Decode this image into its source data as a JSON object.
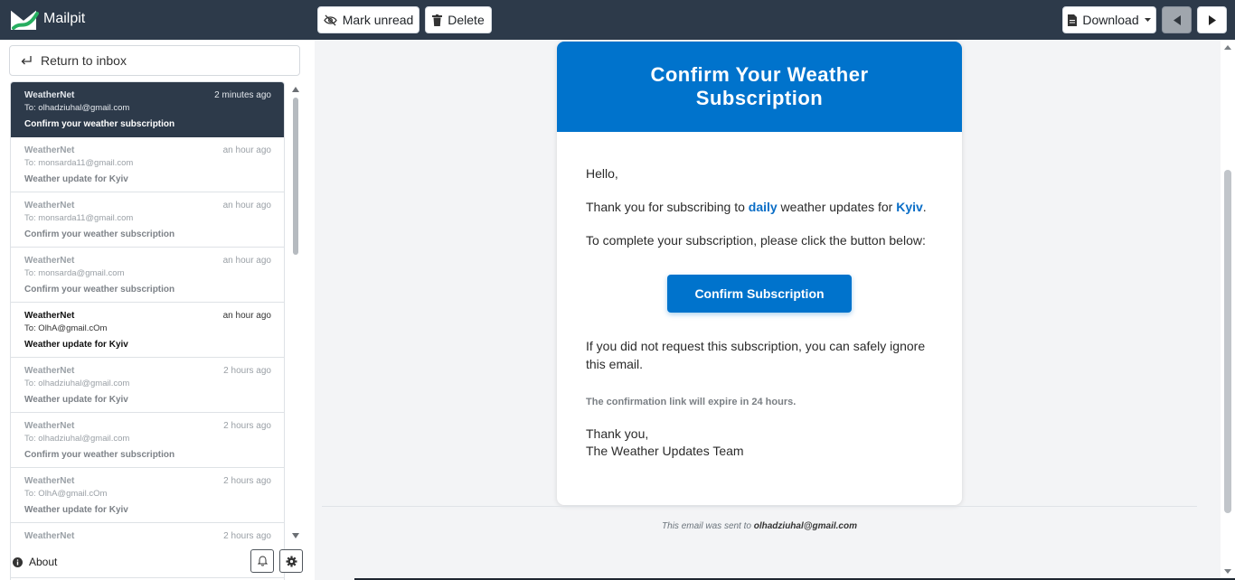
{
  "app": {
    "name": "Mailpit",
    "accent": "#2d3a4a",
    "brand_blue": "#0073cc"
  },
  "toolbar": {
    "mark_unread": "Mark unread",
    "delete": "Delete",
    "download": "Download",
    "prev_icon": "triangle-left-icon",
    "next_icon": "triangle-right-icon"
  },
  "sidebar": {
    "return_label": "Return to inbox",
    "about_label": "About",
    "messages": [
      {
        "from": "WeatherNet",
        "time": "2 minutes ago",
        "to": "To: olhadziuhal@gmail.com",
        "subject": "Confirm your weather subscription",
        "state": "active"
      },
      {
        "from": "WeatherNet",
        "time": "an hour ago",
        "to": "To: monsarda11@gmail.com",
        "subject": "Weather update for Kyiv",
        "state": "read"
      },
      {
        "from": "WeatherNet",
        "time": "an hour ago",
        "to": "To: monsarda11@gmail.com",
        "subject": "Confirm your weather subscription",
        "state": "read"
      },
      {
        "from": "WeatherNet",
        "time": "an hour ago",
        "to": "To: monsarda@gmail.com",
        "subject": "Confirm your weather subscription",
        "state": "read"
      },
      {
        "from": "WeatherNet",
        "time": "an hour ago",
        "to": "To: OlhA@gmail.cOm",
        "subject": "Weather update for Kyiv",
        "state": "unread"
      },
      {
        "from": "WeatherNet",
        "time": "2 hours ago",
        "to": "To: olhadziuhal@gmail.com",
        "subject": "Weather update for Kyiv",
        "state": "read"
      },
      {
        "from": "WeatherNet",
        "time": "2 hours ago",
        "to": "To: olhadziuhal@gmail.com",
        "subject": "Confirm your weather subscription",
        "state": "read"
      },
      {
        "from": "WeatherNet",
        "time": "2 hours ago",
        "to": "To: OlhA@gmail.cOm",
        "subject": "Weather update for Kyiv",
        "state": "read"
      },
      {
        "from": "WeatherNet",
        "time": "2 hours ago",
        "to": "",
        "subject": "",
        "state": "read"
      }
    ]
  },
  "email": {
    "header_title": "Confirm Your Weather Subscription",
    "greeting": "Hello,",
    "thanks_prefix": "Thank you for subscribing to ",
    "frequency": "daily",
    "thanks_middle": " weather updates for ",
    "city": "Kyiv",
    "thanks_suffix": ".",
    "instruction": "To complete your subscription, please click the button below:",
    "button_label": "Confirm Subscription",
    "ignore_note": "If you did not request this subscription, you can safely ignore this email.",
    "expiry_note": "The confirmation link will expire in 24 hours.",
    "signoff_line1": "Thank you,",
    "signoff_line2": "The Weather Updates Team"
  },
  "footer": {
    "sent_prefix": "This email was sent to ",
    "recipient": "olhadziuhal@gmail.com"
  }
}
